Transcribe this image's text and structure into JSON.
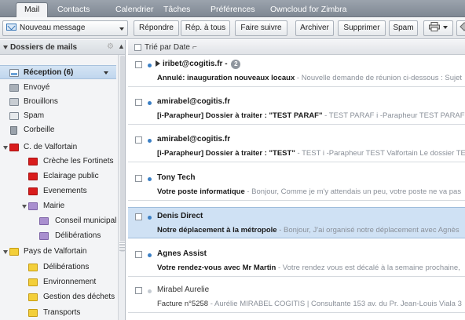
{
  "tabs": [
    {
      "label": "Mail",
      "active": true
    },
    {
      "label": "Contacts"
    },
    {
      "label": "Calendrier"
    },
    {
      "label": "Tâches"
    },
    {
      "label": "Préférences"
    },
    {
      "label": "Owncloud for Zimbra"
    }
  ],
  "toolbar": {
    "new_message": "Nouveau message",
    "reply": "Répondre",
    "reply_all": "Rép. à tous",
    "forward": "Faire suivre",
    "archive": "Archiver",
    "delete": "Supprimer",
    "spam": "Spam",
    "print_icon": "printer-icon",
    "tag_icon": "tag-icon"
  },
  "sidebar": {
    "header": "Dossiers de mails",
    "folders": [
      {
        "label": "Réception (6)",
        "icon": "inbox",
        "selected": true
      },
      {
        "label": "Envoyé",
        "icon": "sent"
      },
      {
        "label": "Brouillons",
        "icon": "drafts"
      },
      {
        "label": "Spam",
        "icon": "spam"
      },
      {
        "label": "Corbeille",
        "icon": "trash"
      },
      {
        "label": "C. de Valfortain",
        "icon": "folder-red",
        "expanded": true
      },
      {
        "label": "Crèche les Fortinets",
        "icon": "folder-red"
      },
      {
        "label": "Eclairage public",
        "icon": "folder-red"
      },
      {
        "label": "Evenements",
        "icon": "folder-red"
      },
      {
        "label": "Mairie",
        "icon": "folder-purple",
        "expanded": true
      },
      {
        "label": "Conseil municipal",
        "icon": "folder-purple"
      },
      {
        "label": "Délibérations",
        "icon": "folder-purple"
      },
      {
        "label": "Pays de Valfortain",
        "icon": "folder-yellow",
        "expanded": true
      },
      {
        "label": "Délibérations",
        "icon": "folder-yellow"
      },
      {
        "label": "Environnement",
        "icon": "folder-yellow"
      },
      {
        "label": "Gestion des déchets",
        "icon": "folder-yellow"
      },
      {
        "label": "Transports",
        "icon": "folder-yellow"
      }
    ]
  },
  "list": {
    "sort_label": "Trié par Date",
    "messages": [
      {
        "sender": "iribet@cogitis.fr",
        "sender_suffix": " - ",
        "count": "2",
        "thread": true,
        "unread": true,
        "subject": "Annulé: inauguration nouveaux locaux",
        "snippet": " - Nouvelle demande de réunion ci-dessous : Sujet"
      },
      {
        "sender": "amirabel@cogitis.fr",
        "unread": true,
        "subject": "[i-Parapheur] Dossier à traiter : \"TEST PARAF\"",
        "snippet": " - TEST PARAF i -Parapheur TEST PARAF V"
      },
      {
        "sender": "amirabel@cogitis.fr",
        "unread": true,
        "subject": "[i-Parapheur] Dossier à traiter : \"TEST\"",
        "snippet": " - TEST i -Parapheur TEST Valfortain Le dossier TE"
      },
      {
        "sender": "Tony Tech",
        "unread": true,
        "subject": "Votre poste informatique",
        "snippet": " - Bonjour, Comme je m'y attendais un peu, votre poste ne va pas"
      },
      {
        "sender": "Denis Direct",
        "unread": true,
        "selected": true,
        "subject": "Notre déplacement à la métropole",
        "snippet": " - Bonjour, J'ai organisé notre déplacement avec Agnès"
      },
      {
        "sender": "Agnes Assist",
        "unread": true,
        "subject": "Votre rendez-vous avec Mr Martin",
        "snippet": " - Votre rendez vous est décalé à la semaine prochaine,"
      },
      {
        "sender": "Mirabel Aurelie",
        "unread": false,
        "subject": "Facture n°5258",
        "snippet": " - Aurélie MIRABEL COGITIS | Consultante 153 av. du Pr. Jean-Louis Viala 3"
      }
    ]
  }
}
